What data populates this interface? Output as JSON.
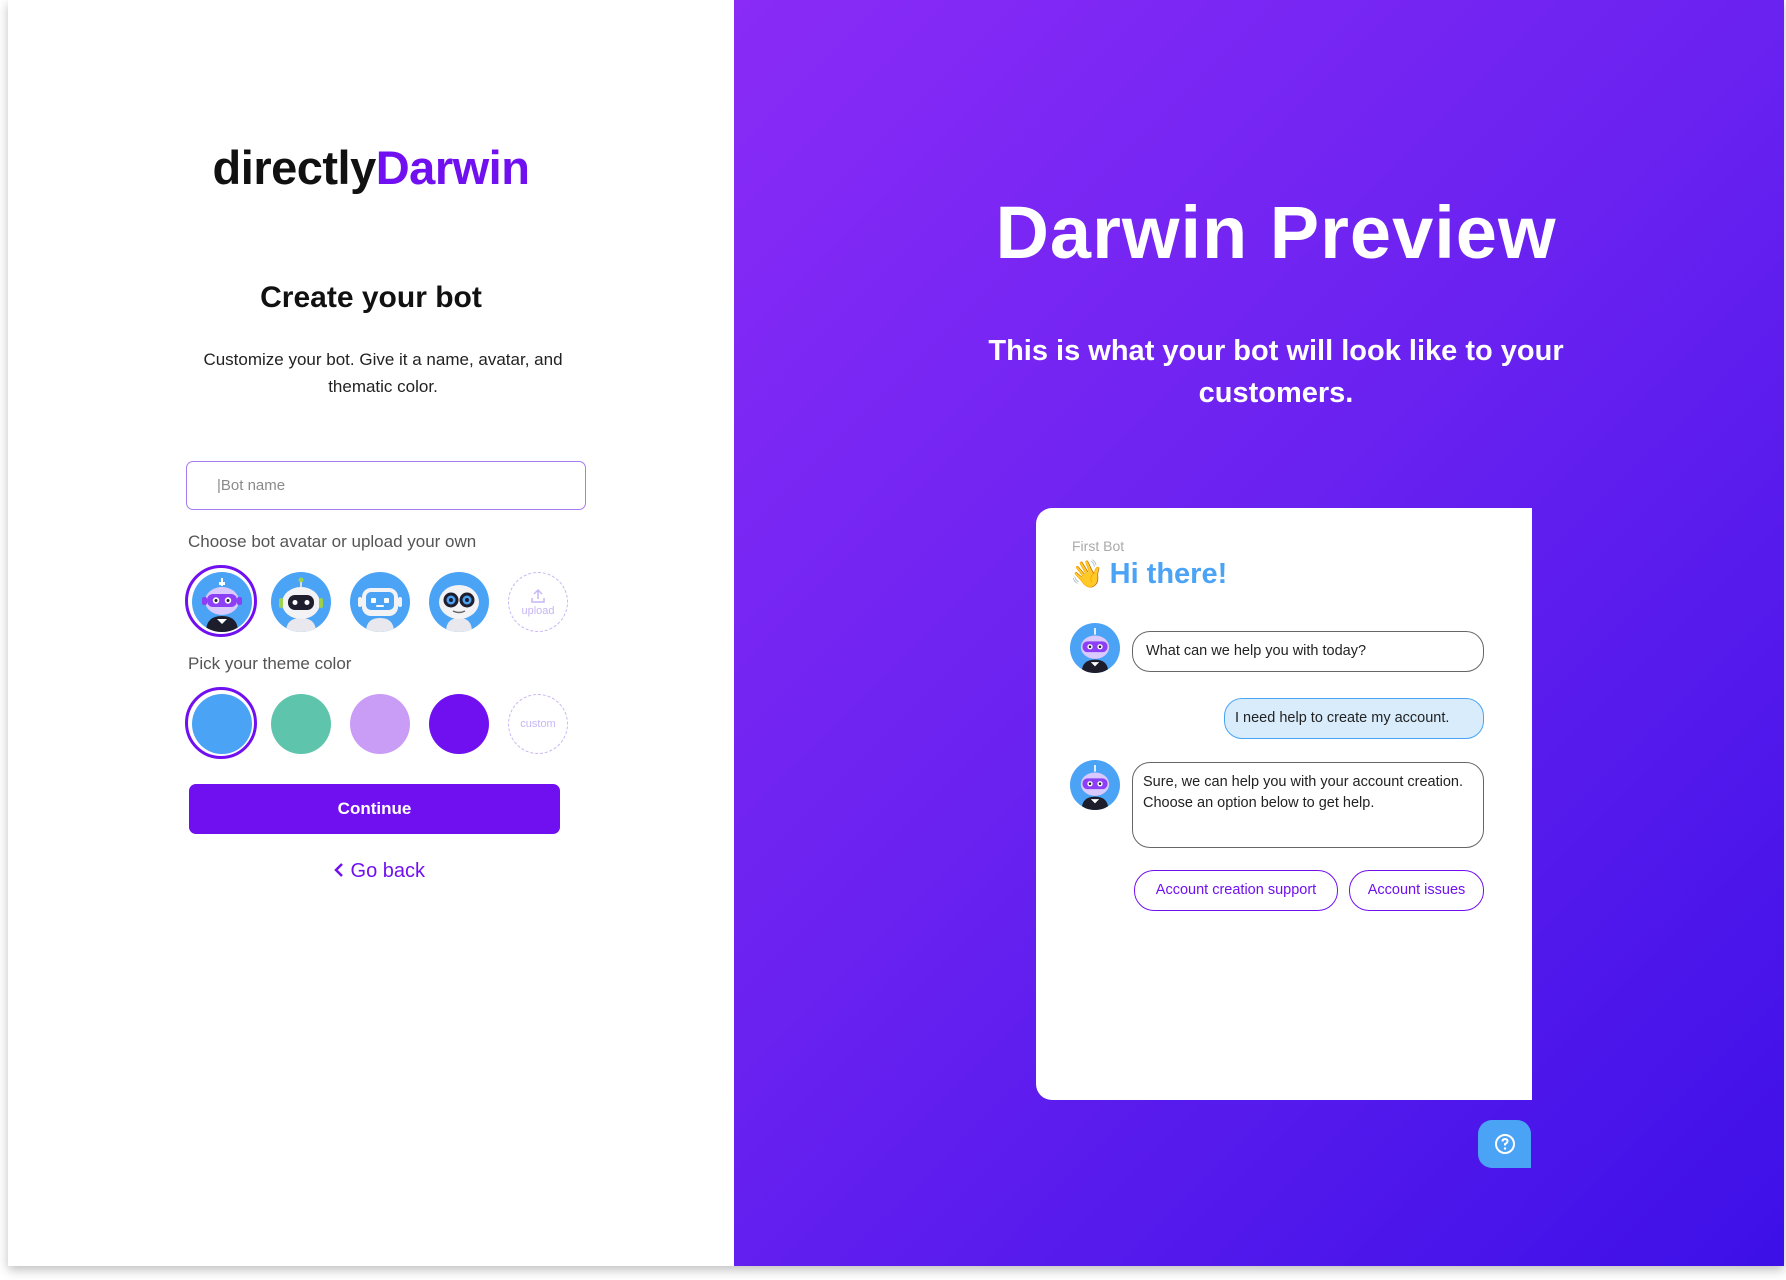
{
  "brand": {
    "part1": "directly",
    "part2": "Darwin"
  },
  "form": {
    "title": "Create your bot",
    "subtitle": "Customize your bot. Give it a name, avatar, and thematic color.",
    "name_placeholder": "|Bot name",
    "avatar_label": "Choose bot avatar or upload your own",
    "avatar_options": [
      "purple-visor-bot",
      "white-round-bot",
      "blue-screen-bot",
      "goggle-eyes-bot"
    ],
    "upload_label": "upload",
    "color_label": "Pick your theme color",
    "colors": [
      "#4aa3f5",
      "#5ec4ac",
      "#c99cf6",
      "#7010f0"
    ],
    "selected_avatar": 0,
    "selected_color": 0,
    "custom_label": "custom",
    "continue_label": "Continue",
    "go_back_label": "Go back"
  },
  "preview": {
    "title": "Darwin Preview",
    "subtitle": "This is what your bot will look like to your customers.",
    "bot_name": "First Bot",
    "greeting": "Hi there!",
    "messages": [
      {
        "from": "bot",
        "text": "What can we help you with today?"
      },
      {
        "from": "user",
        "text": "I need help to create my account."
      },
      {
        "from": "bot",
        "text": "Sure, we can help you with your account creation. Choose an option below to get help."
      }
    ],
    "options": [
      "Account creation support",
      "Account issues"
    ]
  },
  "icons": {
    "upload": "upload-icon",
    "back": "chevron-left-icon",
    "wave": "waving-hand-icon",
    "help": "question-circle-icon"
  }
}
